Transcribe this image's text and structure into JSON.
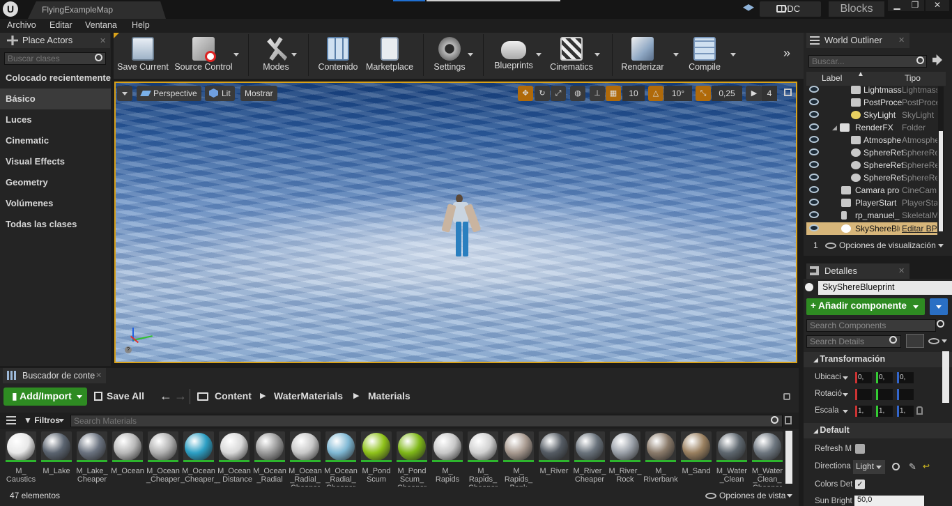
{
  "titlebar": {
    "tab": "FlyingExampleMap",
    "ddc": "DDC",
    "blocks": "Blocks",
    "min": "▁",
    "max": "❐",
    "close": "✕"
  },
  "menu": [
    "Archivo",
    "Editar",
    "Ventana",
    "Help"
  ],
  "place_actors": {
    "tab": "Place Actors",
    "search_placeholder": "Buscar clases",
    "categories": [
      "Colocado recientemente",
      "Básico",
      "Luces",
      "Cinematic",
      "Visual Effects",
      "Geometry",
      "Volúmenes",
      "Todas las clases"
    ],
    "selected": "Básico"
  },
  "toolbar": [
    "Save Current",
    "Source Control",
    "Modes",
    "Contenido",
    "Marketplace",
    "Settings",
    "Blueprints",
    "Cinematics",
    "Renderizar",
    "Compile"
  ],
  "viewport": {
    "perspective": "Perspective",
    "lit": "Lit",
    "show": "Mostrar",
    "grid_snap": "10",
    "rot_snap": "10°",
    "scale_snap": "0,25",
    "cam_speed": "4"
  },
  "outliner": {
    "tab": "World Outliner",
    "search_placeholder": "Buscar...",
    "col_label": "Label",
    "col_type": "Tipo",
    "rows": [
      {
        "name": "Lightmass",
        "type": "LightmassI"
      },
      {
        "name": "PostProce",
        "type": "PostProce"
      },
      {
        "name": "SkyLight",
        "type": "SkyLight"
      },
      {
        "name": "RenderFX",
        "type": "Folder"
      },
      {
        "name": "Atmosphe",
        "type": "Atmosphe"
      },
      {
        "name": "SphereRef",
        "type": "SphereRef"
      },
      {
        "name": "SphereRef",
        "type": "SphereRef"
      },
      {
        "name": "SphereRef",
        "type": "SphereRef"
      },
      {
        "name": "Camara proc",
        "type": "CineCam"
      },
      {
        "name": "PlayerStart",
        "type": "PlayerSta"
      },
      {
        "name": "rp_manuel_ri",
        "type": "SkeletalM"
      },
      {
        "name": "SkyShereBlu",
        "type": "Editar BP"
      }
    ],
    "count": "1",
    "view_options": "Opciones de visualización"
  },
  "details": {
    "tab": "Detalles",
    "object_name": "SkyShereBlueprint",
    "add_component": "Añadir componente",
    "search_components": "Search Components",
    "search_details": "Search Details",
    "section_transform": "Transformación",
    "loc_label": "Ubicaci",
    "rot_label": "Rotació",
    "scale_label": "Escala",
    "loc": [
      "0,",
      "0,",
      "0,"
    ],
    "scale": [
      "1,",
      "1,",
      "1,"
    ],
    "section_default": "Default",
    "refresh": "Refresh M",
    "direction": "Directiona",
    "direction_value": "Light",
    "colors": "Colors Det",
    "sun_bright": "Sun Bright",
    "sun_bright_value": "50,0"
  },
  "content_browser": {
    "tab": "Buscador de conte",
    "add_import": "Add/Import",
    "save_all": "Save All",
    "path": [
      "Content",
      "WaterMaterials",
      "Materials"
    ],
    "filters": "Filtros",
    "search_placeholder": "Search Materials",
    "items": [
      {
        "name": "M_ Caustics",
        "color": "#e8e8e8"
      },
      {
        "name": "M_Lake",
        "color": "#5b6470"
      },
      {
        "name": "M_Lake_ Cheaper",
        "color": "#6b7380"
      },
      {
        "name": "M_Ocean",
        "color": "#b8b8b8"
      },
      {
        "name": "M_Ocean _Cheaper",
        "color": "#b0b0b0"
      },
      {
        "name": "M_Ocean _Cheaper_Inst",
        "color": "#2c9fc4"
      },
      {
        "name": "M_Ocean _ Distance",
        "color": "#d8d8d8"
      },
      {
        "name": "M_Ocean _Radial",
        "color": "#9a9a9a"
      },
      {
        "name": "M_Ocean _Radial_ Cheaper",
        "color": "#c8c8c8"
      },
      {
        "name": "M_Ocean _Radial_ Cheaper",
        "color": "#7fb8d4"
      },
      {
        "name": "M_Pond Scum",
        "color": "#8fc21a"
      },
      {
        "name": "M_Pond Scum_ Cheaper",
        "color": "#7fb818"
      },
      {
        "name": "M_ Rapids",
        "color": "#c8c8c8"
      },
      {
        "name": "M_ Rapids_ Cheaper",
        "color": "#d0d0d0"
      },
      {
        "name": "M_ Rapids_ Bank",
        "color": "#a89a90"
      },
      {
        "name": "M_River",
        "color": "#555c64"
      },
      {
        "name": "M_River_ Cheaper",
        "color": "#6a737c"
      },
      {
        "name": "M_River_ Rock",
        "color": "#9aa0a8"
      },
      {
        "name": "M_ Riverbank",
        "color": "#8a7a6a"
      },
      {
        "name": "M_Sand",
        "color": "#9a8060"
      },
      {
        "name": "M_Water _Clean",
        "color": "#5f6870"
      },
      {
        "name": "M_Water _Clean_ Cheaper",
        "color": "#6e7780"
      }
    ],
    "count": "47 elementos",
    "view_options": "Opciones de vista"
  }
}
